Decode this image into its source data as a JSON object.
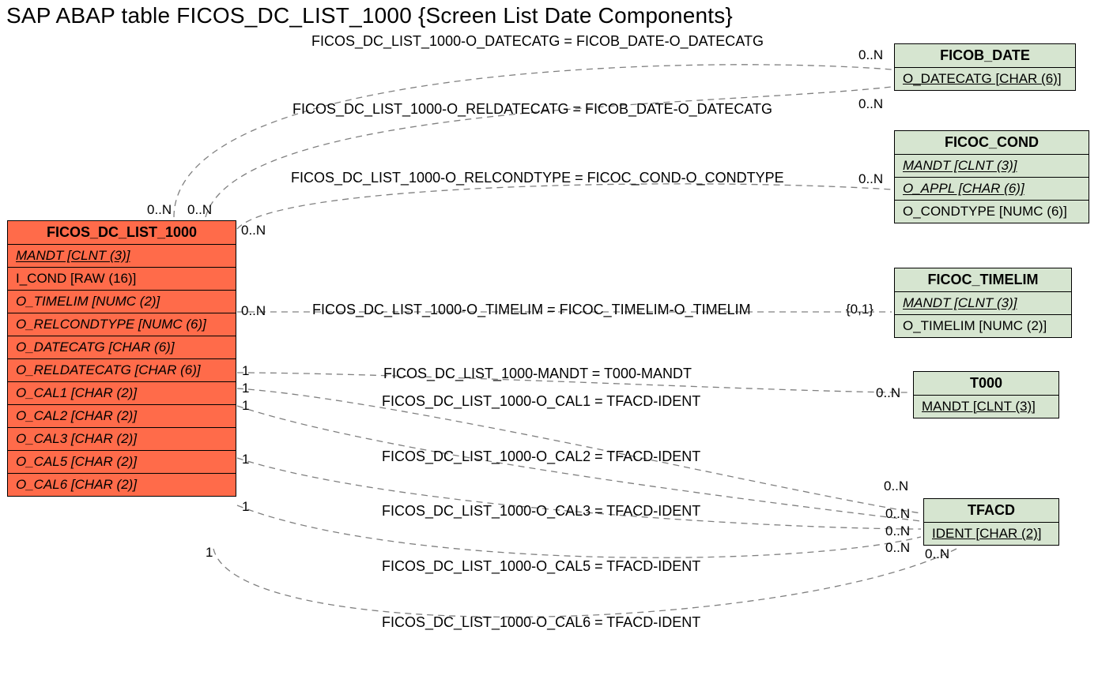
{
  "diagram": {
    "title": "SAP ABAP table FICOS_DC_LIST_1000 {Screen List Date Components}",
    "entities": {
      "main": {
        "name": "FICOS_DC_LIST_1000",
        "rows": [
          {
            "text": "MANDT [CLNT (3)]",
            "style": "fk-ui"
          },
          {
            "text": "I_COND [RAW (16)]",
            "style": ""
          },
          {
            "text": "O_TIMELIM [NUMC (2)]",
            "style": "fk-i"
          },
          {
            "text": "O_RELCONDTYPE [NUMC (6)]",
            "style": "fk-i"
          },
          {
            "text": "O_DATECATG [CHAR (6)]",
            "style": "fk-i"
          },
          {
            "text": "O_RELDATECATG [CHAR (6)]",
            "style": "fk-i"
          },
          {
            "text": "O_CAL1 [CHAR (2)]",
            "style": "fk-i"
          },
          {
            "text": "O_CAL2 [CHAR (2)]",
            "style": "fk-i"
          },
          {
            "text": "O_CAL3 [CHAR (2)]",
            "style": "fk-i"
          },
          {
            "text": "O_CAL5 [CHAR (2)]",
            "style": "fk-i"
          },
          {
            "text": "O_CAL6 [CHAR (2)]",
            "style": "fk-i"
          }
        ]
      },
      "ficob_date": {
        "name": "FICOB_DATE",
        "rows": [
          {
            "text": "O_DATECATG [CHAR (6)]",
            "style": "fk-underline"
          }
        ]
      },
      "ficoc_cond": {
        "name": "FICOC_COND",
        "rows": [
          {
            "text": "MANDT [CLNT (3)]",
            "style": "fk-ui"
          },
          {
            "text": "O_APPL [CHAR (6)]",
            "style": "fk-ui"
          },
          {
            "text": "O_CONDTYPE [NUMC (6)]",
            "style": ""
          }
        ]
      },
      "ficoc_timelim": {
        "name": "FICOC_TIMELIM",
        "rows": [
          {
            "text": "MANDT [CLNT (3)]",
            "style": "fk-ui"
          },
          {
            "text": "O_TIMELIM [NUMC (2)]",
            "style": ""
          }
        ]
      },
      "t000": {
        "name": "T000",
        "rows": [
          {
            "text": "MANDT [CLNT (3)]",
            "style": "fk-underline"
          }
        ]
      },
      "tfacd": {
        "name": "TFACD",
        "rows": [
          {
            "text": "IDENT [CHAR (2)]",
            "style": "fk-underline"
          }
        ]
      }
    },
    "relationships": [
      {
        "label": "FICOS_DC_LIST_1000-O_DATECATG = FICOB_DATE-O_DATECATG",
        "left_card": "0..N",
        "right_card": "0..N"
      },
      {
        "label": "FICOS_DC_LIST_1000-O_RELDATECATG = FICOB_DATE-O_DATECATG",
        "left_card": "0..N",
        "right_card": "0..N"
      },
      {
        "label": "FICOS_DC_LIST_1000-O_RELCONDTYPE = FICOC_COND-O_CONDTYPE",
        "left_card": "0..N",
        "right_card": "0..N"
      },
      {
        "label": "FICOS_DC_LIST_1000-O_TIMELIM = FICOC_TIMELIM-O_TIMELIM",
        "left_card": "0..N",
        "right_card": "{0,1}"
      },
      {
        "label": "FICOS_DC_LIST_1000-MANDT = T000-MANDT",
        "left_card": "1",
        "right_card": "0..N"
      },
      {
        "label": "FICOS_DC_LIST_1000-O_CAL1 = TFACD-IDENT",
        "left_card": "1",
        "right_card": "0..N"
      },
      {
        "label": "FICOS_DC_LIST_1000-O_CAL2 = TFACD-IDENT",
        "left_card": "1",
        "right_card": "0..N"
      },
      {
        "label": "FICOS_DC_LIST_1000-O_CAL3 = TFACD-IDENT",
        "left_card": "1",
        "right_card": "0..N"
      },
      {
        "label": "FICOS_DC_LIST_1000-O_CAL5 = TFACD-IDENT",
        "left_card": "1",
        "right_card": "0..N"
      },
      {
        "label": "FICOS_DC_LIST_1000-O_CAL6 = TFACD-IDENT",
        "left_card": "1",
        "right_card": "0..N"
      }
    ]
  }
}
